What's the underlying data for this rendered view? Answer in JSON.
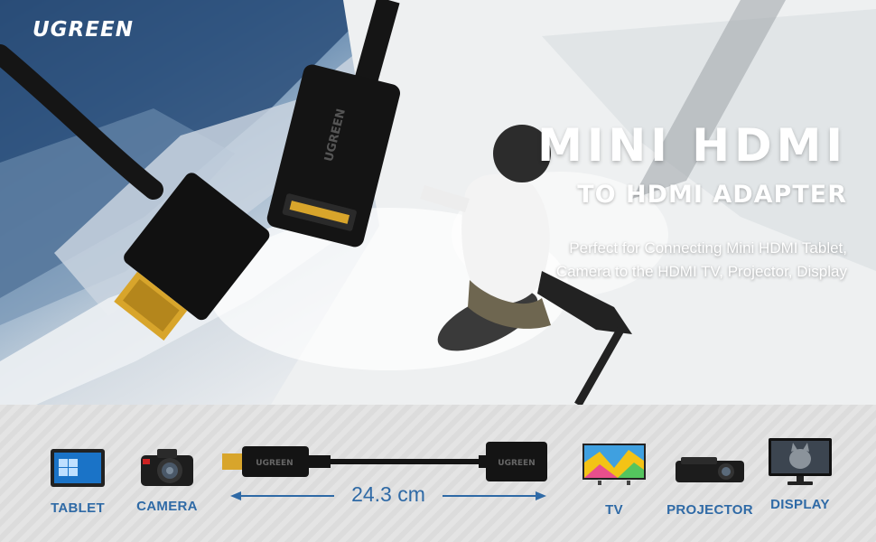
{
  "brand": {
    "logo_text": "UGREEN"
  },
  "hero": {
    "title": "MINI HDMI",
    "subtitle": "TO HDMI ADAPTER",
    "tagline_line1": "Perfect for Connecting Mini HDMI Tablet,",
    "tagline_line2": "Camera to the HDMI TV, Projector, Display"
  },
  "product": {
    "connector_brand_text": "UGREEN",
    "cable_length": "24.3 cm"
  },
  "devices": {
    "tablet": "TABLET",
    "camera": "CAMERA",
    "tv": "TV",
    "projector": "PROJECTOR",
    "display": "DISPLAY"
  },
  "colors": {
    "label_blue": "#2f6aa6",
    "strip_gray": "#e0e0e0",
    "connector_black": "#151515",
    "gold": "#d8a52b"
  }
}
